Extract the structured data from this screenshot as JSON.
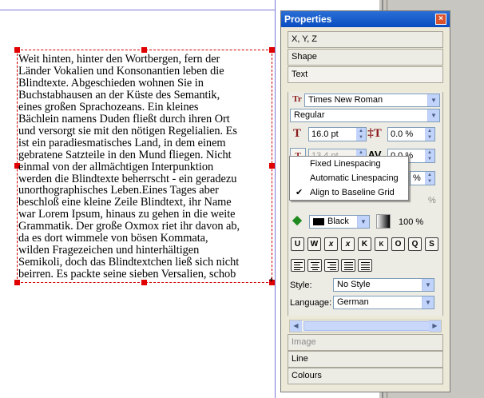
{
  "text_frame": {
    "lines": [
      "Weit hinten, hinter den Wortbergen, fern der",
      "Länder Vokalien und Konsonantien leben die",
      "Blindtexte. Abgeschieden wohnen Sie in",
      "Buchstabhausen an der Küste des Semantik,",
      "eines großen Sprachozeans. Ein kleines",
      "Bächlein namens Duden fließt durch ihren Ort",
      "und versorgt sie mit den nötigen Regelialien. Es",
      "ist ein paradiesmatisches Land, in dem einem",
      "gebratene Satzteile in den Mund fliegen. Nicht",
      "einmal von der allmächtigen Interpunktion",
      "werden die Blindtexte beherrscht - ein geradezu",
      "unorthographisches Leben.Eines Tages aber",
      "beschloß eine kleine Zeile Blindtext, ihr Name",
      "war Lorem Ipsum, hinaus zu gehen in die weite",
      "Grammatik. Der große Oxmox riet ihr davon ab,",
      "da es dort wimmele von bösen Kommata,",
      "wilden Fragezeichen und hinterhältigen",
      "Semikoli, doch das Blindtextchen ließ sich nicht",
      "beirren. Es packte seine sieben Versalien, schob"
    ],
    "overflow_marker": "+"
  },
  "panel": {
    "title": "Properties",
    "close_glyph": "×",
    "sections": {
      "xyz": "X, Y, Z",
      "shape": "Shape",
      "text": "Text",
      "image": "Image",
      "line": "Line",
      "colours": "Colours"
    },
    "font_family": "Times New Roman",
    "font_style": "Regular",
    "font_size": "16.0 pt",
    "scale_height": "0.0 %",
    "line_spacing": "13.4 pt",
    "tracking": "0.0 %",
    "row3_percent_partial": "%",
    "row4_percent_partial": "%",
    "fill_color": "Black",
    "fill_shade": "100 %",
    "format_buttons": [
      "U",
      "W",
      "x",
      "x",
      "K",
      "K",
      "O",
      "Q",
      "S"
    ],
    "style_label": "Style:",
    "style_value": "No Style",
    "language_label": "Language:",
    "language_value": "German"
  },
  "linespacing_menu": {
    "items": [
      {
        "label": "Fixed Linespacing",
        "checked": false
      },
      {
        "label": "Automatic Linespacing",
        "checked": false
      },
      {
        "label": "Align to Baseline Grid",
        "checked": true
      }
    ],
    "check_glyph": "✔"
  },
  "icons": {
    "font_icon": "font-type-icon",
    "font_size_icon": "font-size-icon",
    "scale_height_icon": "scale-height-icon",
    "line_spacing_icon": "line-spacing-icon",
    "tracking_icon": "tracking-icon",
    "fill_icon": "paint-bucket-icon",
    "shade_icon": "gradient-shade-icon"
  },
  "colors": {
    "titlebar": "#0a4cc0",
    "frame_border": "#d00000",
    "panel_bg": "#ece9d8"
  }
}
